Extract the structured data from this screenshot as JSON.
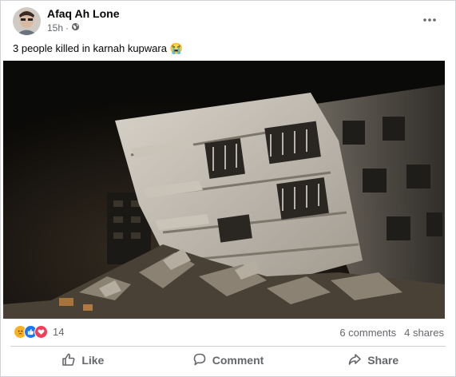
{
  "post": {
    "author": "Afaq Ah Lone",
    "time": "15h",
    "privacy_icon": "globe-icon",
    "text": "3 people killed in karnah kupwara",
    "text_emoji": "😭"
  },
  "engagement": {
    "reaction_icons": [
      "sad-reaction-icon",
      "like-reaction-icon",
      "love-reaction-icon"
    ],
    "reaction_count": "14",
    "comments": "6 comments",
    "shares": "4 shares"
  },
  "actions": {
    "like": "Like",
    "comment": "Comment",
    "share": "Share"
  },
  "colors": {
    "muted_text": "#65676b",
    "like_blue": "#1877f2",
    "love_red": "#f33e58",
    "sad_yellow": "#f7b125"
  }
}
